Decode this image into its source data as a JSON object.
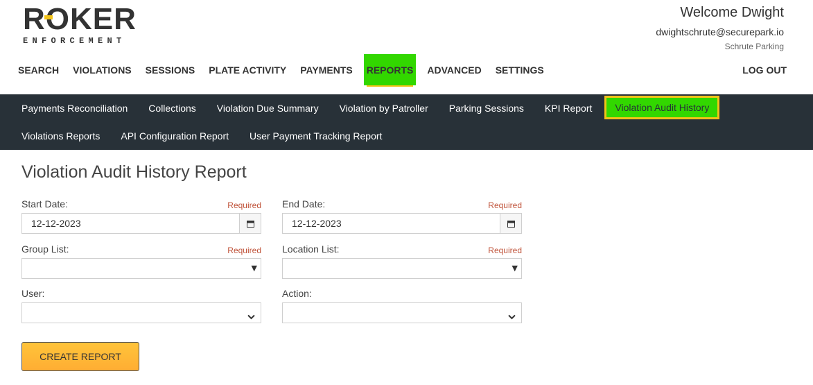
{
  "header": {
    "logo_main": "ROKER",
    "logo_sub": "ENFORCEMENT",
    "welcome": "Welcome Dwight",
    "email": "dwightschrute@securepark.io",
    "company": "Schrute Parking"
  },
  "mainnav": {
    "items": [
      "SEARCH",
      "VIOLATIONS",
      "SESSIONS",
      "PLATE ACTIVITY",
      "PAYMENTS",
      "REPORTS",
      "ADVANCED",
      "SETTINGS"
    ],
    "active": "REPORTS",
    "logout": "LOG OUT"
  },
  "subnav": {
    "row1": [
      "Payments Reconciliation",
      "Collections",
      "Violation Due Summary",
      "Violation by Patroller",
      "Parking Sessions",
      "KPI Report",
      "Violation Audit History"
    ],
    "row2": [
      "Violations Reports",
      "API Configuration Report",
      "User Payment Tracking Report"
    ],
    "active": "Violation Audit History"
  },
  "page": {
    "title": "Violation Audit History Report"
  },
  "form": {
    "start_date": {
      "label": "Start Date:",
      "required": "Required",
      "value": "12-12-2023"
    },
    "end_date": {
      "label": "End Date:",
      "required": "Required",
      "value": "12-12-2023"
    },
    "group_list": {
      "label": "Group List:",
      "required": "Required",
      "value": ""
    },
    "location_list": {
      "label": "Location List:",
      "required": "Required",
      "value": ""
    },
    "user": {
      "label": "User:",
      "value": ""
    },
    "action": {
      "label": "Action:",
      "value": ""
    },
    "submit_label": "CREATE REPORT"
  },
  "colors": {
    "accent_yellow": "#f2c318",
    "highlight_green": "#32d700",
    "subnav_bg": "#283138",
    "required_text": "#c0533a",
    "button_orange": "#ffad33"
  },
  "icons": {
    "date_picker": "calendar-icon",
    "select_legacy": "triangle-down-icon",
    "select_modern": "chevron-down-icon"
  }
}
